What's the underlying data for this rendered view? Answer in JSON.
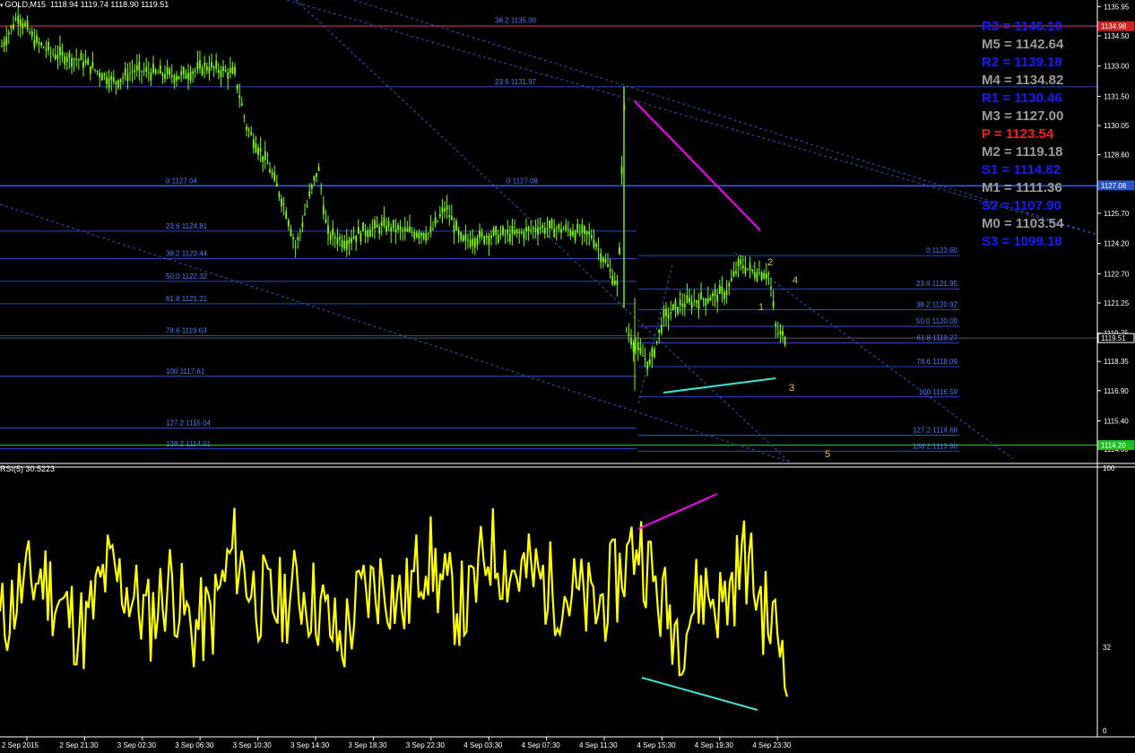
{
  "header": {
    "symbol": "GOLD,M15",
    "ohlc": "1118.94 1119.74 1118.90 1119.51",
    "rsi_label": "RSI(5) 30.5223"
  },
  "price_axis": {
    "ticks": [
      "1135.95",
      "1134.50",
      "1133.00",
      "1131.50",
      "1130.05",
      "1128.60",
      "1127.10",
      "1125.70",
      "1124.20",
      "1122.70",
      "1121.25",
      "1119.75",
      "1118.35",
      "1116.90",
      "1115.40",
      "1114.00"
    ],
    "tags": [
      {
        "label": "1134.98",
        "color": "#cc2222"
      },
      {
        "label": "1127.08",
        "color": "#2a56c8"
      },
      {
        "label": "1119.51",
        "color": "#000000"
      },
      {
        "label": "1114.20",
        "color": "#22bb22"
      }
    ]
  },
  "rsi_axis": {
    "ticks": [
      "100",
      "32",
      "0"
    ]
  },
  "time_axis": {
    "labels": [
      "2 Sep 2015",
      "2 Sep 21:30",
      "3 Sep 02:30",
      "3 Sep 06:30",
      "3 Sep 10:30",
      "3 Sep 14:30",
      "3 Sep 18:30",
      "3 Sep 22:30",
      "4 Sep 03:30",
      "4 Sep 07:30",
      "4 Sep 11:30",
      "4 Sep 15:30",
      "4 Sep 19:30",
      "4 Sep 23:30"
    ]
  },
  "pivots": [
    {
      "label": "R3 = 1146.10",
      "color": "#1a1aff"
    },
    {
      "label": "M5 = 1142.64",
      "color": "#9a9a9a"
    },
    {
      "label": "R2 = 1139.18",
      "color": "#1a1aff"
    },
    {
      "label": "M4 = 1134.82",
      "color": "#9a9a9a"
    },
    {
      "label": "R1 = 1130.46",
      "color": "#1a1aff"
    },
    {
      "label": "M3 = 1127.00",
      "color": "#9a9a9a"
    },
    {
      "label": "P  = 1123.54",
      "color": "#ff1a1a"
    },
    {
      "label": "M2 = 1119.18",
      "color": "#9a9a9a"
    },
    {
      "label": "S1 = 1114.82",
      "color": "#1a1aff"
    },
    {
      "label": "M1 = 1111.36",
      "color": "#9a9a9a"
    },
    {
      "label": "S2 = 1107.90",
      "color": "#1a1aff"
    },
    {
      "label": "M0 = 1103.54",
      "color": "#9a9a9a"
    },
    {
      "label": "S3 = 1099.18",
      "color": "#1a1aff"
    }
  ],
  "fib_left": [
    "38.2 1135.00",
    "23.6 1131.97",
    "0 1127.04",
    "23.6 1124.81",
    "38.2 1123.44",
    "50.0 1122.32",
    "61.8 1121.21",
    "78.6 1119.63",
    "100 1117.61",
    "127.2 1115.04",
    "138.2 1114.01"
  ],
  "fib_mid": [
    "0 1127.08"
  ],
  "fib_right": [
    "0 1123.60",
    "23.6 1121.95",
    "38.2 1120.92",
    "50.0 1120.09",
    "61.8 1119.27",
    "78.6 1118.09",
    "100 1116.59",
    "127.2 1114.68",
    "138.2 1113.90"
  ],
  "wave_labels": [
    "2",
    "4",
    "1",
    "3",
    "5"
  ],
  "colors": {
    "candle": "#7cfc00",
    "rsi": "#ffff00",
    "fib": "#3a5cff",
    "trend": "#2a56c8",
    "magenta": "#ff00ff",
    "cyan": "#40e0d0"
  },
  "chart_data": [
    {
      "type": "candlestick",
      "title": "GOLD,M15",
      "xlabel": "",
      "ylabel": "",
      "ylim": [
        1113.6,
        1136.5
      ],
      "close_path": [
        [
          "2 Sep 2015",
          1134.0
        ],
        [
          "2 Sep 21:30",
          1133.2
        ],
        [
          "3 Sep 02:30",
          1132.3
        ],
        [
          "3 Sep 06:30",
          1132.4
        ],
        [
          "3 Sep 10:30",
          1127.5
        ],
        [
          "3 Sep 14:30",
          1124.6
        ],
        [
          "3 Sep 18:30",
          1124.7
        ],
        [
          "3 Sep 22:30",
          1124.9
        ],
        [
          "4 Sep 03:30",
          1124.4
        ],
        [
          "4 Sep 07:30",
          1124.7
        ],
        [
          "4 Sep 11:30",
          1122.5
        ],
        [
          "4 Sep 15:30",
          1121.2
        ],
        [
          "4 Sep 19:30",
          1121.5
        ],
        [
          "4 Sep 23:30",
          1119.5
        ]
      ],
      "last": 1119.51
    },
    {
      "type": "line",
      "title": "RSI(5) 30.5223",
      "ylim": [
        0,
        100
      ],
      "series": [
        {
          "values": [
            40,
            55,
            60,
            46,
            38,
            62,
            55,
            42,
            58,
            38,
            44,
            71,
            52,
            48,
            55,
            48,
            32,
            52,
            58,
            48,
            70,
            52,
            47,
            72,
            62,
            60,
            55,
            52,
            46,
            58,
            75,
            50,
            38,
            55,
            48,
            68,
            44,
            30
          ]
        }
      ]
    }
  ]
}
